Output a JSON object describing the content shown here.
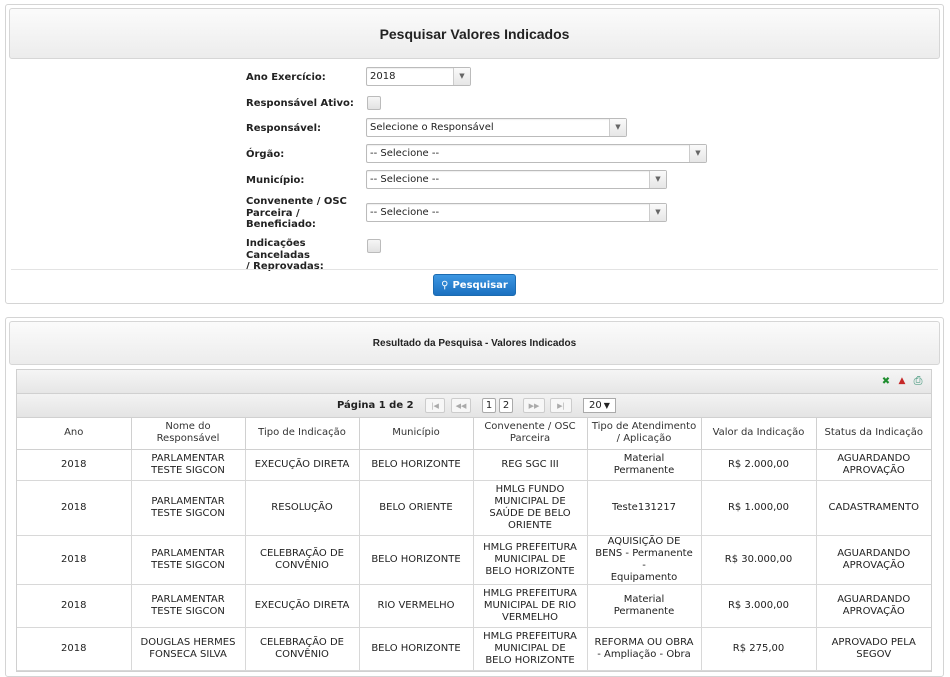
{
  "search": {
    "title": "Pesquisar Valores Indicados",
    "fields": {
      "ano_label": "Ano Exercício:",
      "ano_value": "2018",
      "responsavel_ativo_label": "Responsável Ativo:",
      "responsavel_label": "Responsável:",
      "responsavel_value": "Selecione o Responsável",
      "orgao_label": "Órgão:",
      "orgao_value": "-- Selecione --",
      "municipio_label": "Município:",
      "municipio_value": "-- Selecione --",
      "convenente_label_1": "Convenente / OSC",
      "convenente_label_2": "Parceira /",
      "convenente_label_3": "Beneficiado:",
      "convenente_value": "-- Selecione --",
      "canceladas_label_1": "Indicações Canceladas",
      "canceladas_label_2": "/ Reprovadas:"
    },
    "button_label": "Pesquisar"
  },
  "results": {
    "title": "Resultado da Pesquisa - Valores Indicados",
    "pager": {
      "info": "Página 1 de 2",
      "pages": [
        "1",
        "2"
      ],
      "page_size": "20"
    },
    "columns": [
      [
        "Ano"
      ],
      [
        "Nome do",
        "Responsável"
      ],
      [
        "Tipo de Indicação"
      ],
      [
        "Município"
      ],
      [
        "Convenente / OSC",
        "Parceira"
      ],
      [
        "Tipo de Atendimento",
        "/ Aplicação"
      ],
      [
        "Valor da Indicação"
      ],
      [
        "Status da Indicação"
      ]
    ],
    "rows": [
      {
        "ano": "2018",
        "nome": [
          "PARLAMENTAR",
          "TESTE SIGCON"
        ],
        "tipo": [
          "EXECUÇÃO DIRETA"
        ],
        "municipio": [
          "BELO HORIZONTE"
        ],
        "convenente": [
          "REG SGC III"
        ],
        "atendimento": [
          "Material Permanente"
        ],
        "valor": "R$ 2.000,00",
        "status": [
          "AGUARDANDO",
          "APROVAÇÃO"
        ]
      },
      {
        "ano": "2018",
        "nome": [
          "PARLAMENTAR",
          "TESTE SIGCON"
        ],
        "tipo": [
          "RESOLUÇÃO"
        ],
        "municipio": [
          "BELO ORIENTE"
        ],
        "convenente": [
          "HMLG FUNDO",
          "MUNICIPAL DE",
          "SAÚDE DE BELO",
          "ORIENTE"
        ],
        "atendimento": [
          "Teste131217"
        ],
        "valor": "R$ 1.000,00",
        "status": [
          "CADASTRAMENTO"
        ]
      },
      {
        "ano": "2018",
        "nome": [
          "PARLAMENTAR",
          "TESTE SIGCON"
        ],
        "tipo": [
          "CELEBRAÇÃO DE",
          "CONVÊNIO"
        ],
        "municipio": [
          "BELO HORIZONTE"
        ],
        "convenente": [
          "HMLG PREFEITURA",
          "MUNICIPAL DE",
          "BELO HORIZONTE"
        ],
        "atendimento": [
          "AQUISIÇÃO DE",
          "BENS - Permanente -",
          "Equipamento"
        ],
        "valor": "R$ 30.000,00",
        "status": [
          "AGUARDANDO",
          "APROVAÇÃO"
        ]
      },
      {
        "ano": "2018",
        "nome": [
          "PARLAMENTAR",
          "TESTE SIGCON"
        ],
        "tipo": [
          "EXECUÇÃO DIRETA"
        ],
        "municipio": [
          "RIO VERMELHO"
        ],
        "convenente": [
          "HMLG PREFEITURA",
          "MUNICIPAL DE RIO",
          "VERMELHO"
        ],
        "atendimento": [
          "Material Permanente"
        ],
        "valor": "R$ 3.000,00",
        "status": [
          "AGUARDANDO",
          "APROVAÇÃO"
        ]
      },
      {
        "ano": "2018",
        "nome": [
          "DOUGLAS HERMES",
          "FONSECA SILVA"
        ],
        "tipo": [
          "CELEBRAÇÃO DE",
          "CONVÊNIO"
        ],
        "municipio": [
          "BELO HORIZONTE"
        ],
        "convenente": [
          "HMLG PREFEITURA",
          "MUNICIPAL DE",
          "BELO HORIZONTE"
        ],
        "atendimento": [
          "REFORMA OU OBRA",
          "- Ampliação - Obra"
        ],
        "valor": "R$ 275,00",
        "status": [
          "APROVADO PELA",
          "SEGOV"
        ]
      }
    ]
  }
}
